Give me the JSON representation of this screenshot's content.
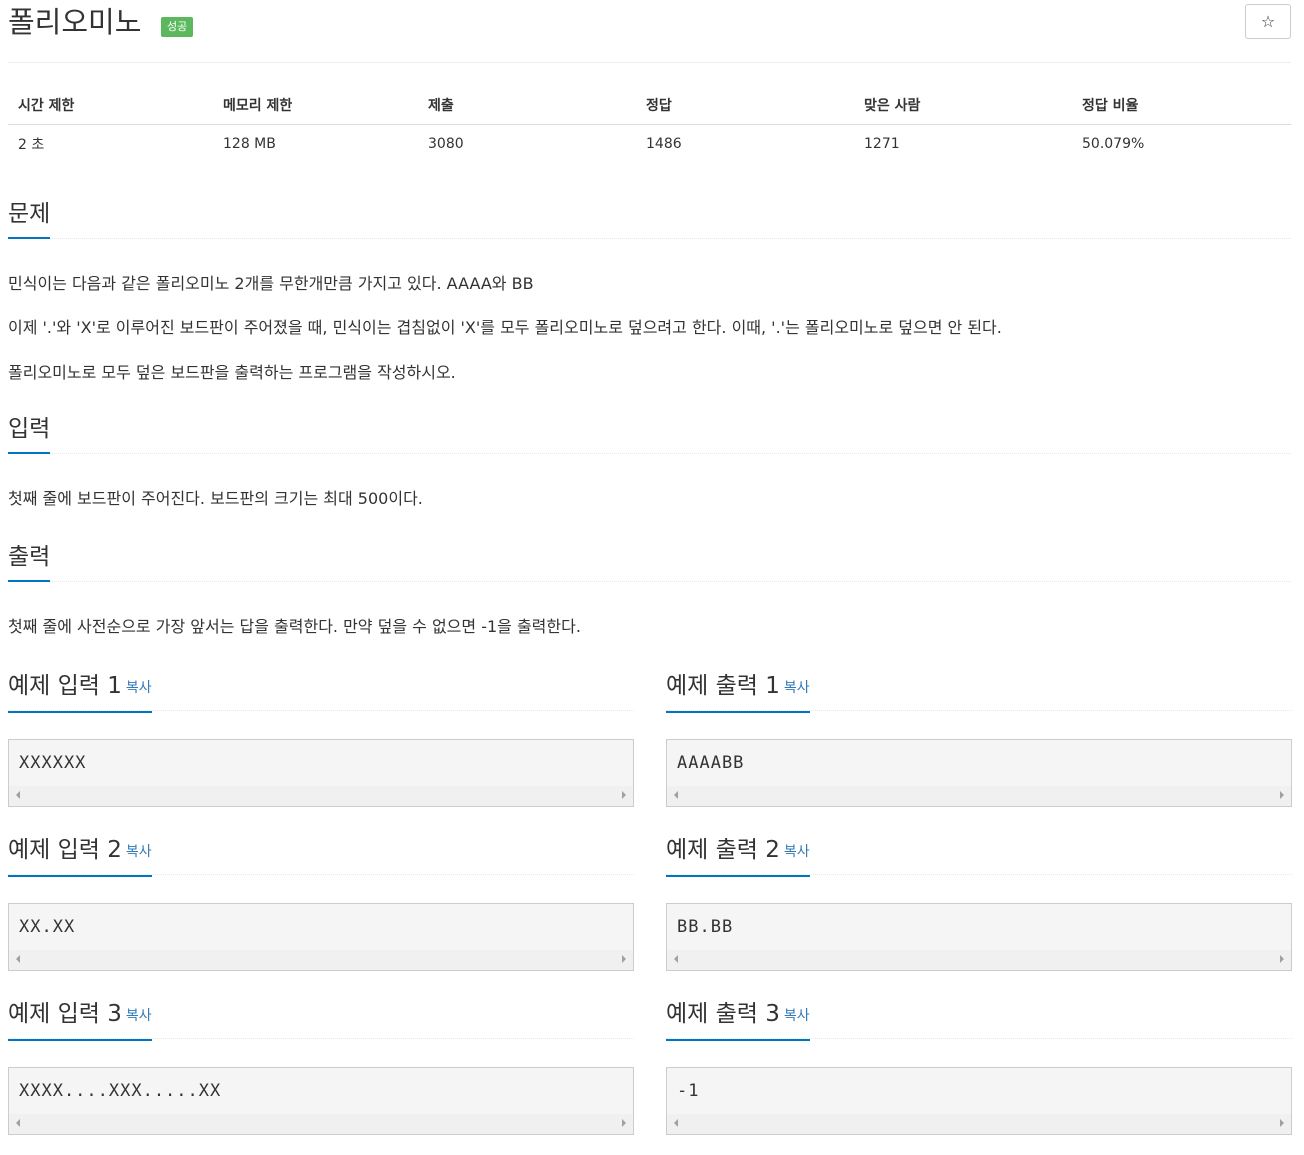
{
  "header": {
    "title": "폴리오미노",
    "badge": "성공",
    "star": "☆"
  },
  "info": {
    "headers": [
      "시간 제한",
      "메모리 제한",
      "제출",
      "정답",
      "맞은 사람",
      "정답 비율"
    ],
    "values": [
      "2 초",
      "128 MB",
      "3080",
      "1486",
      "1271",
      "50.079%"
    ]
  },
  "problem": {
    "heading": "문제",
    "lines": [
      "민식이는 다음과 같은 폴리오미노 2개를 무한개만큼 가지고 있다. AAAA와 BB",
      "이제 '.'와 'X'로 이루어진 보드판이 주어졌을 때, 민식이는 겹침없이 'X'를 모두 폴리오미노로 덮으려고 한다. 이때, '.'는 폴리오미노로 덮으면 안 된다.",
      "폴리오미노로 모두 덮은 보드판을 출력하는 프로그램을 작성하시오."
    ]
  },
  "input": {
    "heading": "입력",
    "lines": [
      "첫째 줄에 보드판이 주어진다. 보드판의 크기는 최대 500이다."
    ]
  },
  "output": {
    "heading": "출력",
    "lines": [
      "첫째 줄에 사전순으로 가장 앞서는 답을 출력한다. 만약 덮을 수 없으면 -1을 출력한다."
    ]
  },
  "samples": [
    {
      "in_title": "예제 입력 1",
      "out_title": "예제 출력 1",
      "copy": "복사",
      "in": "XXXXXX",
      "out": "AAAABB"
    },
    {
      "in_title": "예제 입력 2",
      "out_title": "예제 출력 2",
      "copy": "복사",
      "in": "XX.XX",
      "out": "BB.BB"
    },
    {
      "in_title": "예제 입력 3",
      "out_title": "예제 출력 3",
      "copy": "복사",
      "in": "XXXX....XXX.....XX",
      "out": "-1"
    }
  ]
}
